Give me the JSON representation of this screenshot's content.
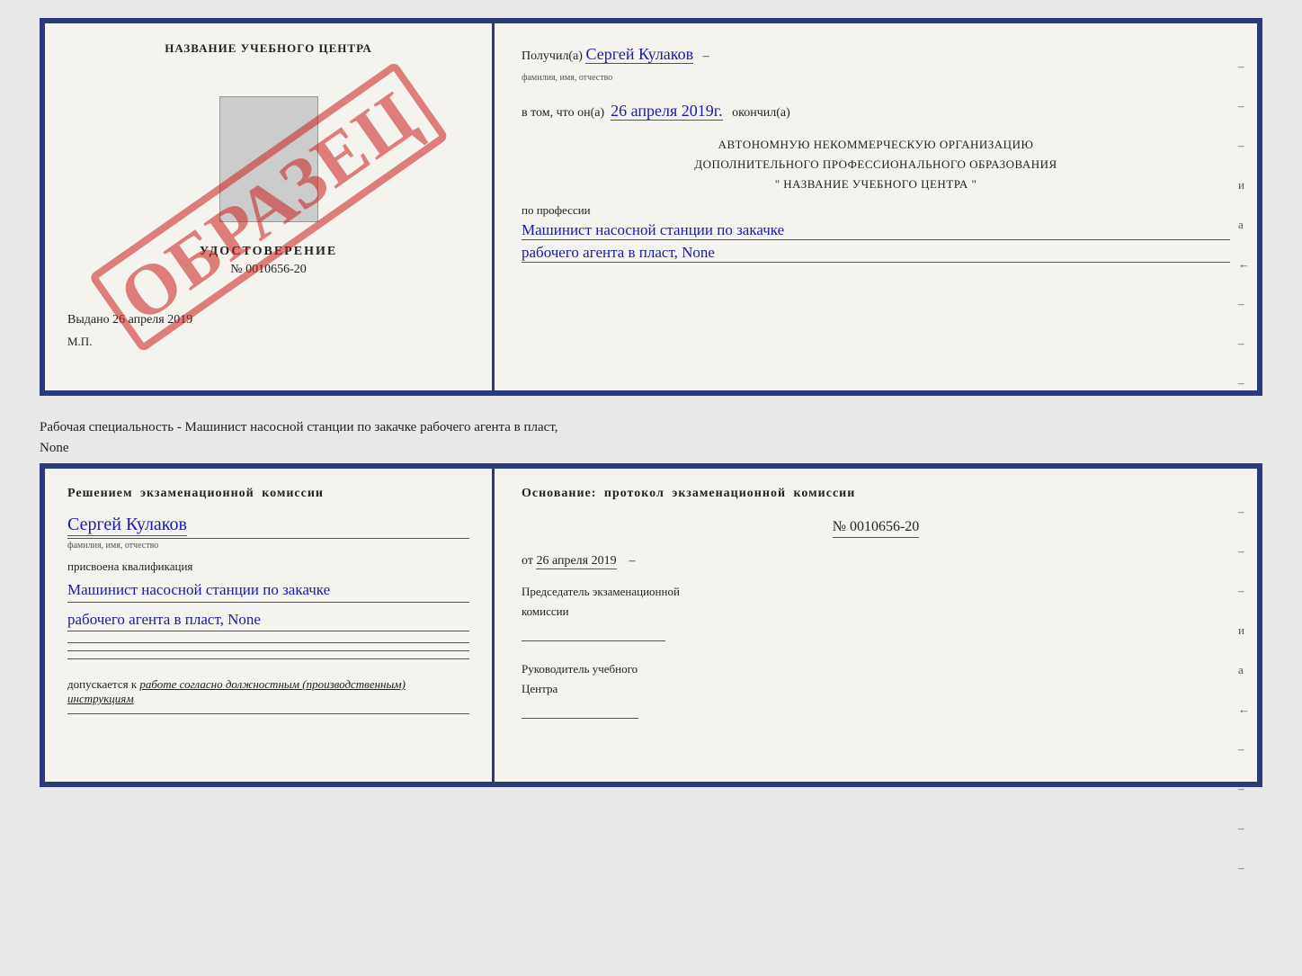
{
  "top_doc": {
    "left": {
      "center_name": "НАЗВАНИЕ УЧЕБНОГО ЦЕНТРА",
      "udostoverenie": "УДОСТОВЕРЕНИЕ",
      "number": "№ 0010656-20",
      "vydano": "Выдано 26 апреля 2019",
      "mp": "М.П.",
      "stamp": "ОБРАЗЕЦ"
    },
    "right": {
      "poluchil_label": "Получил(а)",
      "poluchil_value": "Сергей Кулаков",
      "familiya_hint": "фамилия, имя, отчество",
      "vtom_label": "в том, что он(а)",
      "vtom_value": "26 апреля 2019г.",
      "okonchil_label": "окончил(а)",
      "org_line1": "АВТОНОМНУЮ НЕКОММЕРЧЕСКУЮ ОРГАНИЗАЦИЮ",
      "org_line2": "ДОПОЛНИТЕЛЬНОГО ПРОФЕССИОНАЛЬНОГО ОБРАЗОВАНИЯ",
      "org_line3": "\" НАЗВАНИЕ УЧЕБНОГО ЦЕНТРА \"",
      "po_professii": "по профессии",
      "profession1": "Машинист насосной станции по закачке",
      "profession2": "рабочего агента в пласт, None",
      "dashes": [
        "-",
        "-",
        "-",
        "и",
        "а",
        "←",
        "-",
        "-",
        "-"
      ]
    }
  },
  "middle_text": {
    "line1": "Рабочая специальность - Машинист насосной станции по закачке рабочего агента в пласт,",
    "line2": "None"
  },
  "bottom_doc": {
    "left": {
      "komissia_title": "Решением  экзаменационной  комиссии",
      "name_value": "Сергей Кулаков",
      "familiya_hint": "фамилия, имя, отчество",
      "prisvoena": "присвоена квалификация",
      "qualification1": "Машинист насосной станции по закачке",
      "qualification2": "рабочего агента в пласт, None",
      "dopuskaetsya_prefix": "допускается к",
      "dopuskaetsya_text": "работе согласно должностным (производственным) инструкциям"
    },
    "right": {
      "osnovanie_title": "Основание: протокол экзаменационной  комиссии",
      "number": "№ 0010656-20",
      "date_prefix": "от",
      "date_value": "26 апреля 2019",
      "predsedatel_line1": "Председатель экзаменационной",
      "predsedatel_line2": "комиссии",
      "rukovoditel_line1": "Руководитель учебного",
      "rukovoditel_line2": "Центра",
      "dashes": [
        "-",
        "-",
        "-",
        "и",
        "а",
        "←",
        "-",
        "-",
        "-",
        "-"
      ]
    }
  }
}
